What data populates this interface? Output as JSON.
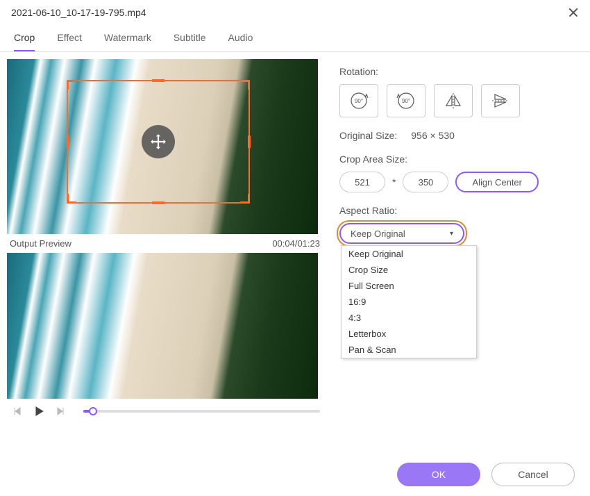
{
  "title": "2021-06-10_10-17-19-795.mp4",
  "tabs": [
    "Crop",
    "Effect",
    "Watermark",
    "Subtitle",
    "Audio"
  ],
  "active_tab": "Crop",
  "preview": {
    "label": "Output Preview",
    "time": "00:04/01:23"
  },
  "rotation": {
    "label": "Rotation:"
  },
  "original_size": {
    "label": "Original Size:",
    "value": "956 × 530"
  },
  "crop_area": {
    "label": "Crop Area Size:",
    "width": "521",
    "height": "350",
    "align": "Align Center"
  },
  "aspect": {
    "label": "Aspect Ratio:",
    "selected": "Keep Original",
    "options": [
      "Keep Original",
      "Crop Size",
      "Full Screen",
      "16:9",
      "4:3",
      "Letterbox",
      "Pan & Scan"
    ]
  },
  "footer": {
    "ok": "OK",
    "cancel": "Cancel"
  }
}
